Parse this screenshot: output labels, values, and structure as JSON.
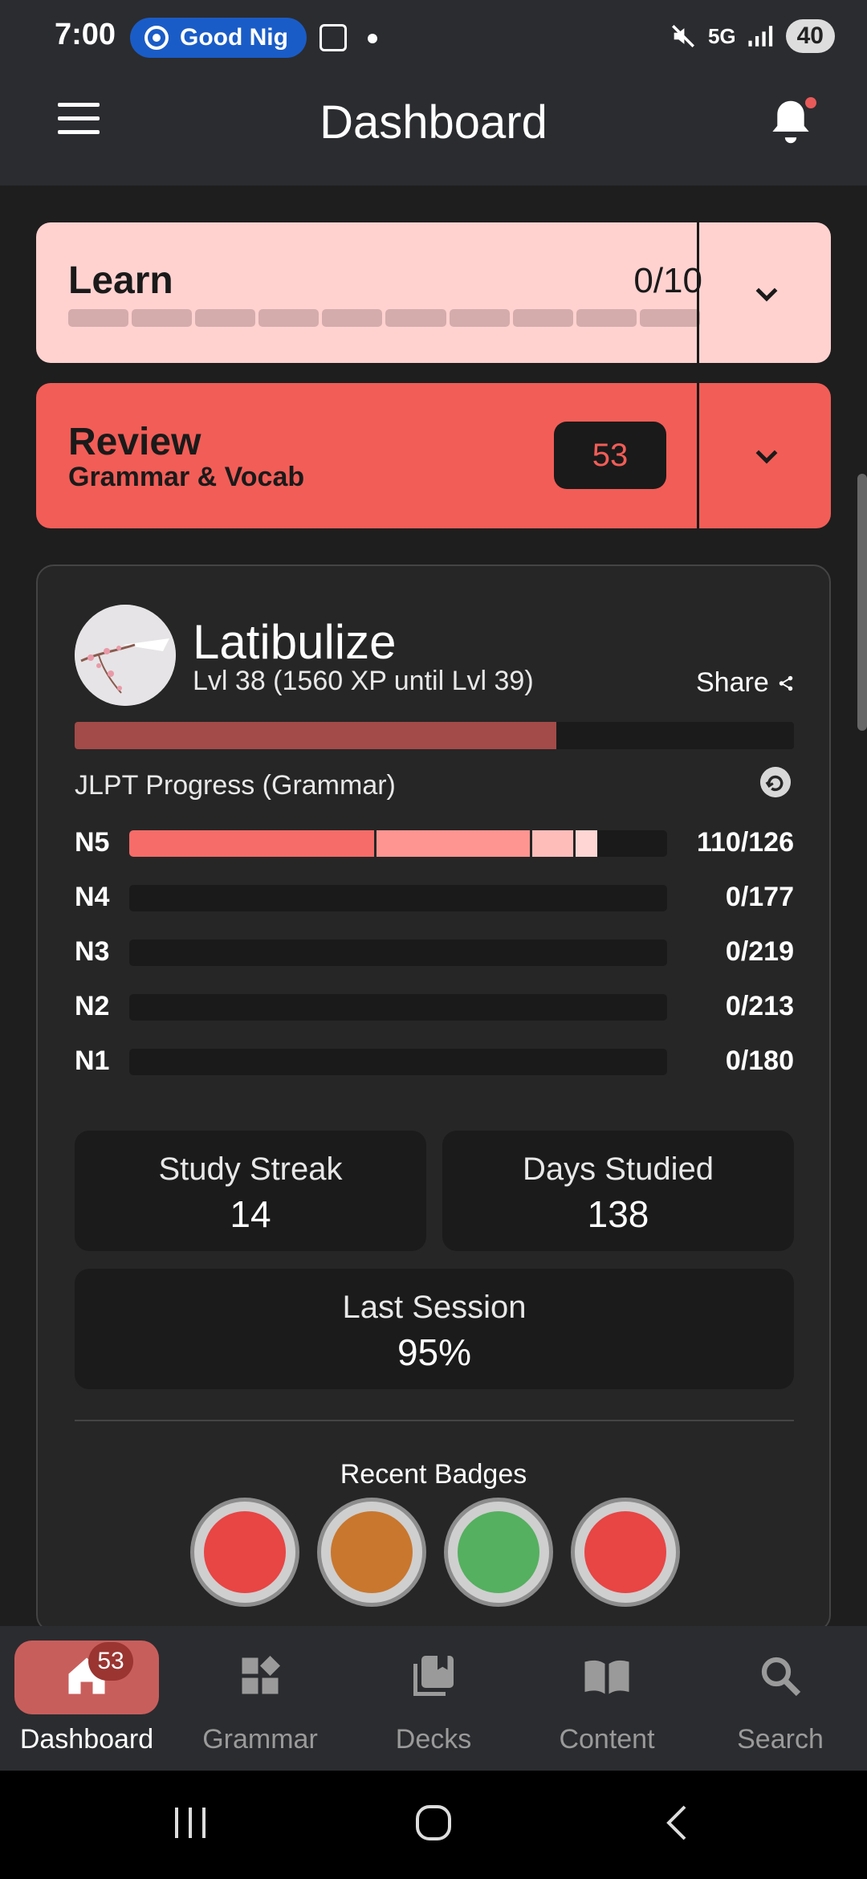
{
  "status_bar": {
    "time": "7:00",
    "notification_pill": "Good Nig",
    "network": "5G",
    "battery": "40"
  },
  "app_bar": {
    "title": "Dashboard"
  },
  "learn": {
    "title": "Learn",
    "count": "0/10",
    "progress_fraction": 0.0,
    "segments": 10
  },
  "review": {
    "title": "Review",
    "subtitle": "Grammar & Vocab",
    "count": "53"
  },
  "profile": {
    "username": "Latibulize",
    "level_text": "Lvl 38 (1560 XP until Lvl 39)",
    "share_label": "Share",
    "xp_progress_fraction": 0.67,
    "jlpt_title": "JLPT Progress (Grammar)",
    "jlpt_levels": [
      {
        "label": "N5",
        "count": "110/126",
        "segments": [
          0.46,
          0.29,
          0.08,
          0.04
        ]
      },
      {
        "label": "N4",
        "count": "0/177",
        "segments": []
      },
      {
        "label": "N3",
        "count": "0/219",
        "segments": []
      },
      {
        "label": "N2",
        "count": "0/213",
        "segments": []
      },
      {
        "label": "N1",
        "count": "0/180",
        "segments": []
      }
    ],
    "stats": {
      "study_streak_label": "Study Streak",
      "study_streak_value": "14",
      "days_studied_label": "Days Studied",
      "days_studied_value": "138",
      "last_session_label": "Last Session",
      "last_session_value": "95%"
    },
    "recent_badges_title": "Recent Badges",
    "badges": [
      {
        "name": "samurai-armor-badge",
        "color": "#e84545"
      },
      {
        "name": "scroll-desk-badge",
        "color": "#c9772e"
      },
      {
        "name": "bamboo-sword-badge",
        "color": "#55b060"
      },
      {
        "name": "katana-badge",
        "color": "#e84545"
      }
    ]
  },
  "bottom_nav": {
    "items": [
      {
        "label": "Dashboard",
        "icon": "home-icon",
        "active": true,
        "badge": "53"
      },
      {
        "label": "Grammar",
        "icon": "grammar-icon",
        "active": false
      },
      {
        "label": "Decks",
        "icon": "decks-icon",
        "active": false
      },
      {
        "label": "Content",
        "icon": "content-icon",
        "active": false
      },
      {
        "label": "Search",
        "icon": "search-icon",
        "active": false
      }
    ]
  },
  "colors": {
    "accent": "#f25d57",
    "learn_bg": "#ffd2d0",
    "xp_bar": "#a34b48"
  }
}
